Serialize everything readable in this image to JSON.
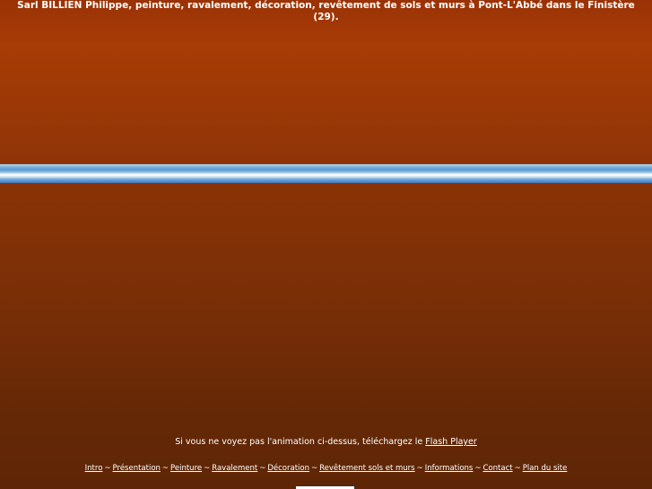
{
  "header": {
    "title_line1": "Sarl BILLIEN Philippe, peinture, ravalement, décoration, revêtement de sols et murs à Pont-L'Abbé dans le Finistère",
    "title_line2": "(29)."
  },
  "flash": {
    "text": "Si vous ne voyez pas l'animation ci-dessus, téléchargez le ",
    "link_label": "Flash Player"
  },
  "nav": {
    "separator": "~",
    "items": [
      {
        "label": "Intro"
      },
      {
        "label": "Présentation"
      },
      {
        "label": "Peinture"
      },
      {
        "label": "Ravalement"
      },
      {
        "label": "Décoration"
      },
      {
        "label": "Revêtement sols et murs"
      },
      {
        "label": "Informations"
      },
      {
        "label": "Contact"
      },
      {
        "label": "Plan du site"
      }
    ]
  },
  "colors": {
    "background_top": "#a83c06",
    "background_bottom": "#5e2606",
    "band_blue": "#5a9bd6",
    "text": "#ffffff"
  }
}
